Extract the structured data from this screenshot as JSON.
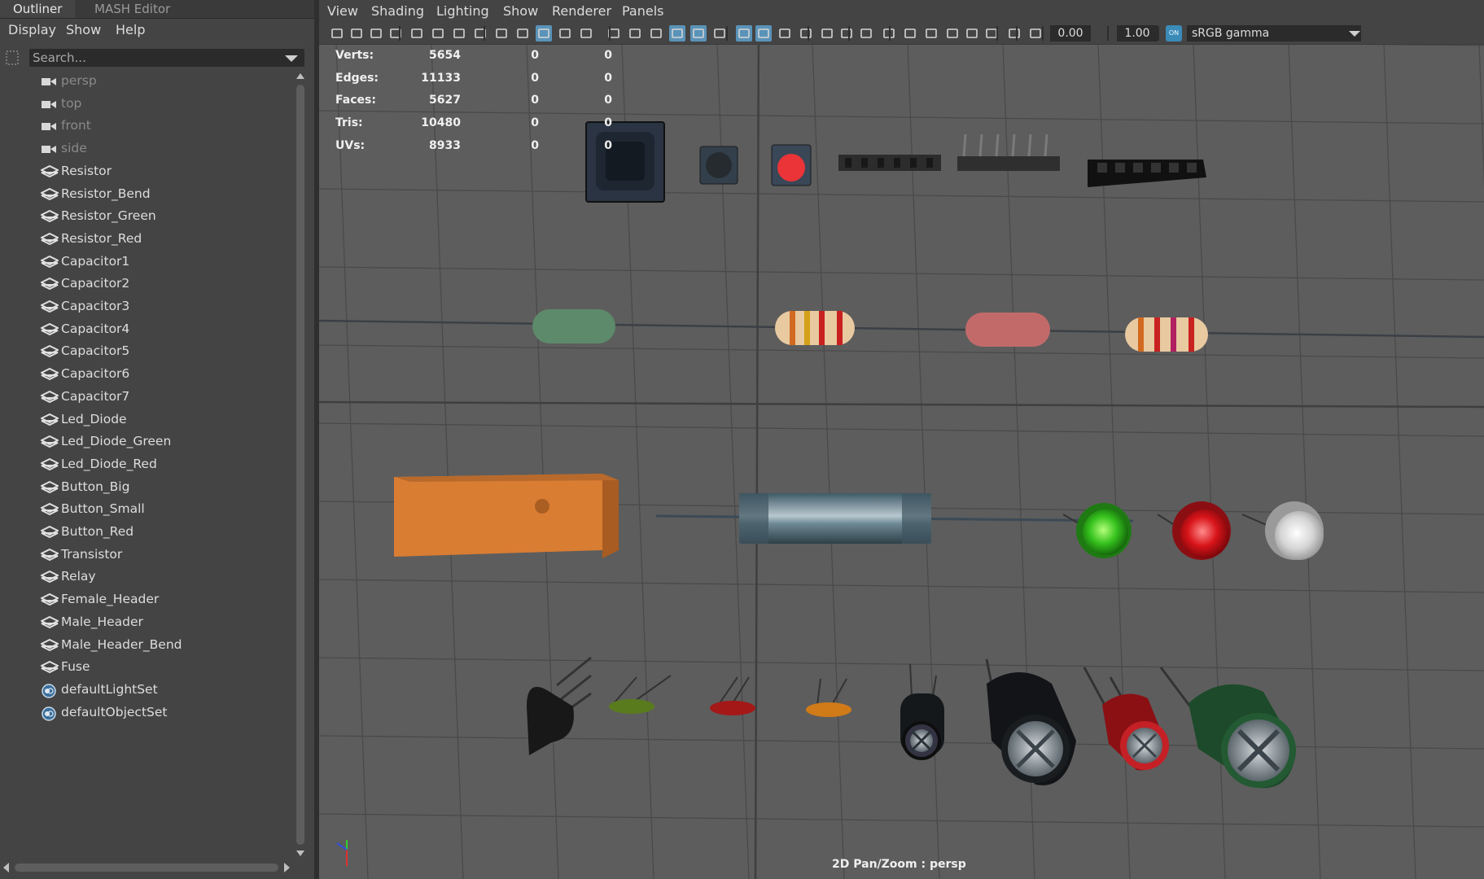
{
  "outliner": {
    "tabs": [
      "Outliner",
      "MASH Editor"
    ],
    "menu": [
      "Display",
      "Show",
      "Help"
    ],
    "search_placeholder": "Search...",
    "items": [
      {
        "label": "persp",
        "type": "camera"
      },
      {
        "label": "top",
        "type": "camera"
      },
      {
        "label": "front",
        "type": "camera"
      },
      {
        "label": "side",
        "type": "camera"
      },
      {
        "label": "Resistor",
        "type": "mesh"
      },
      {
        "label": "Resistor_Bend",
        "type": "mesh"
      },
      {
        "label": "Resistor_Green",
        "type": "mesh"
      },
      {
        "label": "Resistor_Red",
        "type": "mesh"
      },
      {
        "label": "Capacitor1",
        "type": "mesh"
      },
      {
        "label": "Capacitor2",
        "type": "mesh"
      },
      {
        "label": "Capacitor3",
        "type": "mesh"
      },
      {
        "label": "Capacitor4",
        "type": "mesh"
      },
      {
        "label": "Capacitor5",
        "type": "mesh"
      },
      {
        "label": "Capacitor6",
        "type": "mesh"
      },
      {
        "label": "Capacitor7",
        "type": "mesh"
      },
      {
        "label": "Led_Diode",
        "type": "mesh"
      },
      {
        "label": "Led_Diode_Green",
        "type": "mesh"
      },
      {
        "label": "Led_Diode_Red",
        "type": "mesh"
      },
      {
        "label": "Button_Big",
        "type": "mesh"
      },
      {
        "label": "Button_Small",
        "type": "mesh"
      },
      {
        "label": "Button_Red",
        "type": "mesh"
      },
      {
        "label": "Transistor",
        "type": "mesh"
      },
      {
        "label": "Relay",
        "type": "mesh"
      },
      {
        "label": "Female_Header",
        "type": "mesh"
      },
      {
        "label": "Male_Header",
        "type": "mesh"
      },
      {
        "label": "Male_Header_Bend",
        "type": "mesh"
      },
      {
        "label": "Fuse",
        "type": "mesh"
      },
      {
        "label": "defaultLightSet",
        "type": "set"
      },
      {
        "label": "defaultObjectSet",
        "type": "set"
      }
    ]
  },
  "viewport": {
    "menu": [
      "View",
      "Shading",
      "Lighting",
      "Show",
      "Renderer",
      "Panels"
    ],
    "exposure": "0.00",
    "gamma": "1.00",
    "color_space": "sRGB gamma",
    "color_space_badge": "ON",
    "camera_label": "2D Pan/Zoom : persp",
    "hud": {
      "labels": [
        "Verts:",
        "Edges:",
        "Faces:",
        "Tris:",
        "UVs:"
      ],
      "col1": [
        "5654",
        "11133",
        "5627",
        "10480",
        "8933"
      ],
      "col2": [
        "0",
        "0",
        "0",
        "0",
        "0"
      ],
      "col3": [
        "0",
        "0",
        "0",
        "0",
        "0"
      ]
    }
  },
  "colors": {
    "panel_bg": "#444444",
    "viewport_bg": "#5d5d5d",
    "grid_line": "#4a4a4a",
    "active_tool": "#5a93b8"
  }
}
